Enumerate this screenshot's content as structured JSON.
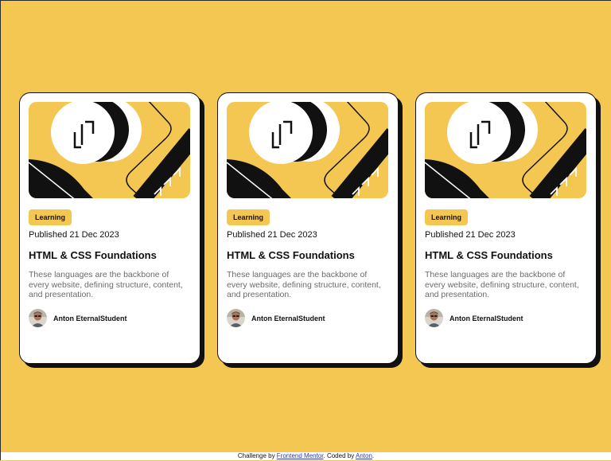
{
  "cards": [
    {
      "tag": "Learning",
      "published": "Published 21 Dec 2023",
      "title": "HTML & CSS Foundations",
      "description": "These languages are the backbone of every website, defining structure, content, and presentation.",
      "author": "Anton EternalStudent"
    },
    {
      "tag": "Learning",
      "published": "Published 21 Dec 2023",
      "title": "HTML & CSS Foundations",
      "description": "These languages are the backbone of every website, defining structure, content, and presentation.",
      "author": "Anton EternalStudent"
    },
    {
      "tag": "Learning",
      "published": "Published 21 Dec 2023",
      "title": "HTML & CSS Foundations",
      "description": "These languages are the backbone of every website, defining structure, content, and presentation.",
      "author": "Anton EternalStudent"
    }
  ],
  "footer": {
    "prefix": "Challenge by ",
    "challenge_link": "Frontend Mentor",
    "middle": ". Coded by ",
    "coder_link": "Anton",
    "suffix": "."
  },
  "colors": {
    "background": "#f4c752",
    "card": "#ffffff",
    "shadow": "#111111",
    "link": "#2a3ab8"
  }
}
